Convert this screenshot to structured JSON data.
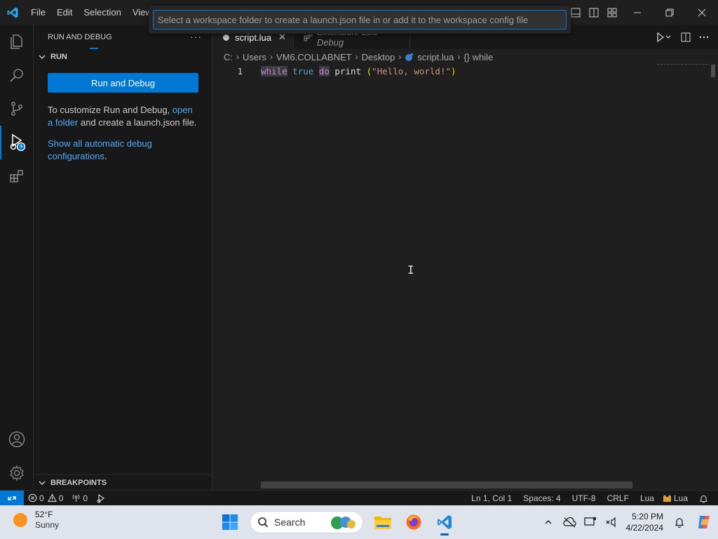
{
  "titlebar": {
    "menu": [
      "File",
      "Edit",
      "Selection",
      "View"
    ],
    "quickpick_placeholder": "Select a workspace folder to create a launch.json file in or add it to the workspace config file"
  },
  "sidebar": {
    "title": "RUN AND DEBUG",
    "section_run": "RUN",
    "run_button": "Run and Debug",
    "customize_text_before": "To customize Run and Debug, ",
    "customize_link": "open a folder",
    "customize_text_after": " and create a launch.json file.",
    "show_configs_link": "Show all automatic debug configurations",
    "show_configs_period": ".",
    "section_breakpoints": "BREAKPOINTS"
  },
  "editor": {
    "tabs": [
      {
        "label": "script.lua",
        "modified": true,
        "active": true
      },
      {
        "label": "Extension: Lua Debug",
        "active": false
      }
    ],
    "breadcrumb": [
      "C:",
      "Users",
      "VM6.COLLABNET",
      "Desktop",
      "script.lua",
      "{} while"
    ],
    "lines": [
      {
        "number": "1",
        "tokens": {
          "kw_while": "while",
          "space1": " ",
          "kw_true": "true",
          "space2": " ",
          "kw_do": "do",
          "space3": " ",
          "fn_print": "print",
          "space4": " ",
          "paren_open": "(",
          "string": "\"Hello, world!\"",
          "paren_close": ")"
        }
      }
    ]
  },
  "statusbar": {
    "errors": "0",
    "warnings": "0",
    "ports": "0",
    "position": "Ln 1, Col 1",
    "spaces": "Spaces: 4",
    "encoding": "UTF-8",
    "eol": "CRLF",
    "language": "Lua",
    "language_ext": "Lua"
  },
  "taskbar": {
    "weather_temp": "52°F",
    "weather_condition": "Sunny",
    "search_label": "Search",
    "time": "5:20 PM",
    "date": "4/22/2024"
  },
  "colors": {
    "accent": "#0078d4",
    "editor_bg": "#1f1f1f",
    "sidebar_bg": "#181818",
    "link": "#4daafc",
    "string": "#ce9178",
    "keyword": "#c586c0"
  }
}
